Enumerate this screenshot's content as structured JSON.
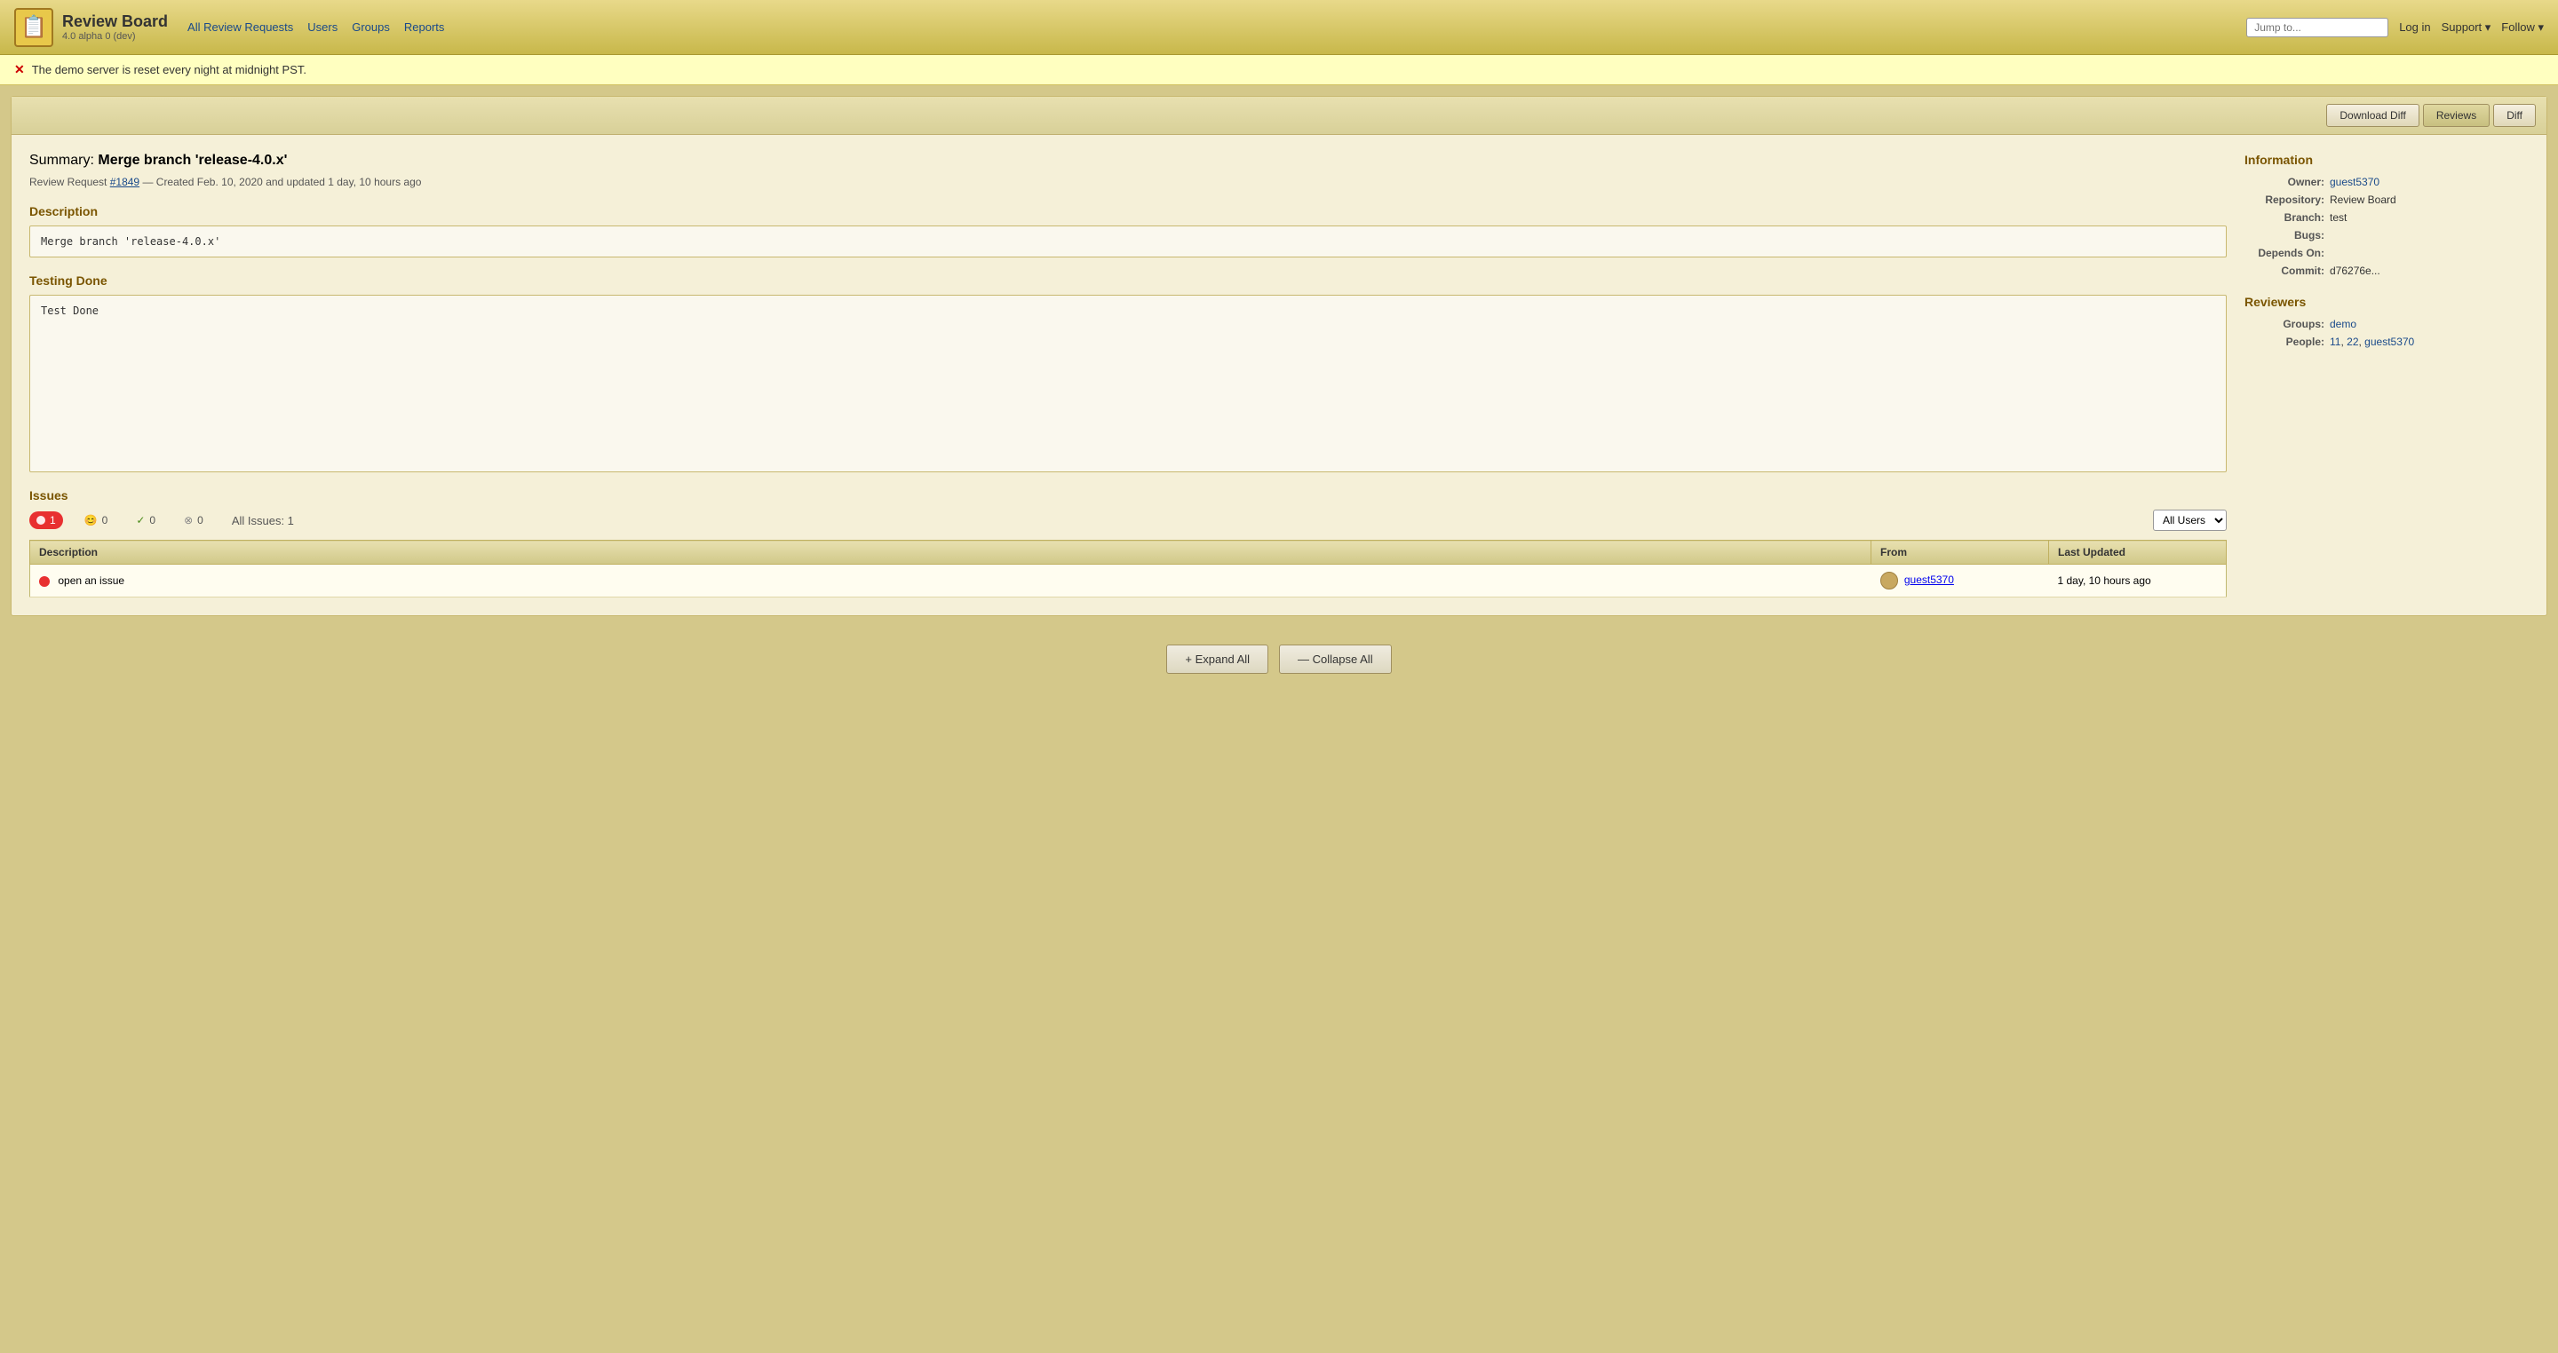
{
  "app": {
    "title": "Review Board",
    "version": "4.0 alpha 0 (dev)",
    "logo_emoji": "📋"
  },
  "nav": {
    "all_review_requests": "All Review Requests",
    "users": "Users",
    "groups": "Groups",
    "reports": "Reports",
    "jump_to_placeholder": "Jump to...",
    "log_in": "Log in",
    "support": "Support ▾",
    "follow": "Follow ▾"
  },
  "alert": {
    "message": "The demo server is reset every night at midnight PST."
  },
  "toolbar": {
    "download_diff": "Download Diff",
    "reviews": "Reviews",
    "diff": "Diff"
  },
  "review": {
    "summary_label": "Summary:",
    "summary": "Merge branch 'release-4.0.x'",
    "meta_prefix": "Review Request",
    "meta_id": "#1849",
    "meta_date": "— Created Feb. 10, 2020 and updated 1 day, 10 hours ago",
    "description_label": "Description",
    "description_text": "Merge branch 'release-4.0.x'",
    "testing_label": "Testing Done",
    "testing_text": "Test Done"
  },
  "information": {
    "title": "Information",
    "owner_label": "Owner:",
    "owner_value": "guest5370",
    "repository_label": "Repository:",
    "repository_value": "Review Board",
    "branch_label": "Branch:",
    "branch_value": "test",
    "bugs_label": "Bugs:",
    "bugs_value": "",
    "depends_on_label": "Depends On:",
    "depends_on_value": "",
    "commit_label": "Commit:",
    "commit_value": "d76276e..."
  },
  "reviewers": {
    "title": "Reviewers",
    "groups_label": "Groups:",
    "groups_value": "demo",
    "people_label": "People:",
    "people_11": "11",
    "people_22": "22",
    "people_guest": "guest5370"
  },
  "issues": {
    "title": "Issues",
    "open_count": 1,
    "resolved_count": 0,
    "verified_count": 0,
    "dropped_count": 0,
    "all_issues_label": "All Issues: 1",
    "user_filter": "All Users",
    "col_description": "Description",
    "col_from": "From",
    "col_last_updated": "Last Updated",
    "rows": [
      {
        "description": "open an issue",
        "from_user": "guest5370",
        "last_updated": "1 day, 10 hours ago"
      }
    ]
  },
  "bottom": {
    "expand_all": "+ Expand All",
    "collapse_all": "— Collapse All"
  }
}
